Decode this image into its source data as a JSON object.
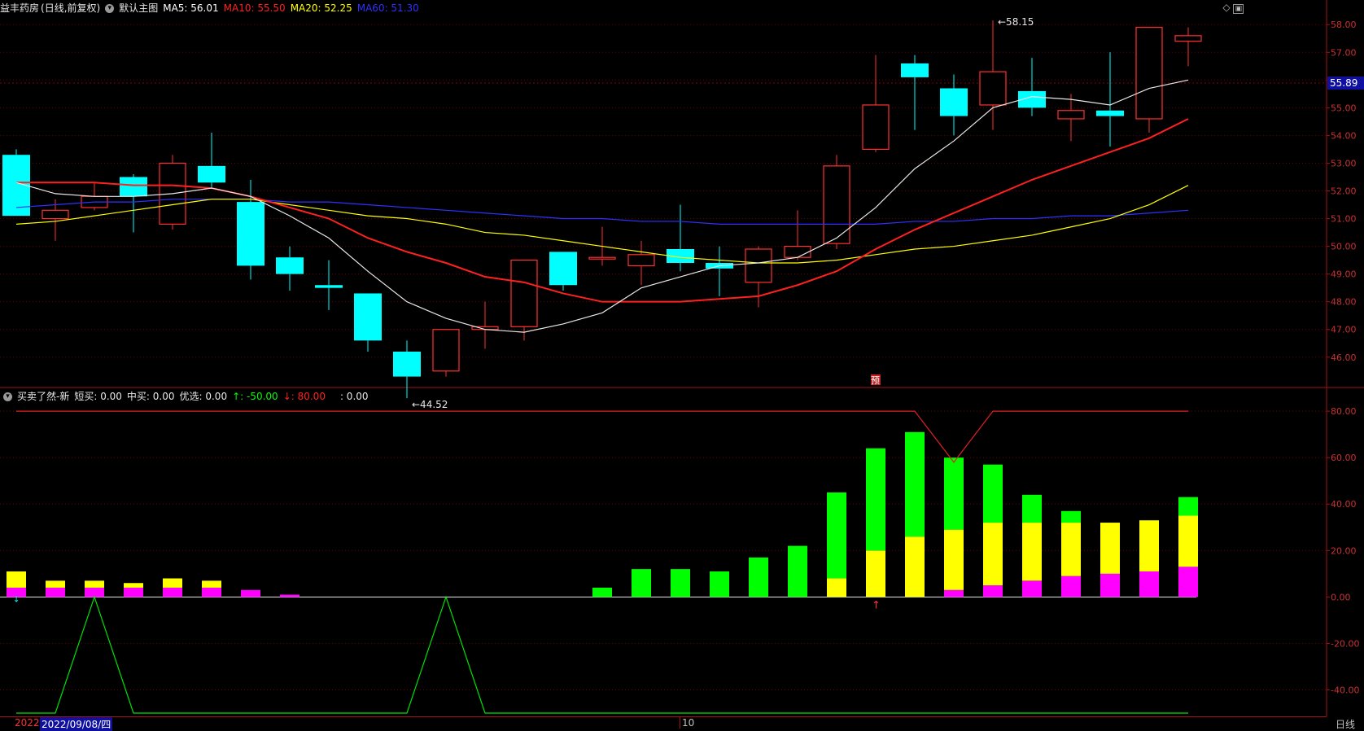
{
  "main_header": {
    "stock": "益丰药房",
    "mode": "(日线,前复权)",
    "template": "默认主图",
    "ma5": "MA5: 56.01",
    "ma10": "MA10: 55.50",
    "ma20": "MA20: 52.25",
    "ma60": "MA60: 51.30",
    "colors": {
      "ma5": "#ffffff",
      "ma10": "#ff2020",
      "ma20": "#ffff00",
      "ma60": "#3030ff"
    }
  },
  "sub_header": {
    "name": "买卖了然-新",
    "short": "短买: 0.00",
    "mid": "中买: 0.00",
    "pick": "优选: 0.00",
    "up": "↑: -50.00",
    "down": "↓: 80.00",
    "extra": ": 0.00"
  },
  "price_axis": {
    "ticks": [
      "58.00",
      "57.00",
      "56.00",
      "55.00",
      "54.00",
      "53.00",
      "52.00",
      "51.00",
      "50.00",
      "49.00",
      "48.00",
      "47.00",
      "46.00"
    ],
    "current": "55.89"
  },
  "indicator_axis": {
    "ticks": [
      "80.00",
      "60.00",
      "40.00",
      "20.00",
      "0.00",
      "-20.00",
      "-40.00"
    ]
  },
  "annotations": {
    "high": "58.15",
    "low": "44.52",
    "marker": "预"
  },
  "bottom": {
    "date_start": "2022",
    "date_selected": "2022/09/08/四",
    "month_mark": "10",
    "period": "日线"
  },
  "chart_data": [
    {
      "type": "candlestick",
      "ylim": [
        45.2,
        58.3
      ],
      "candles": [
        [
          53.3,
          51.1,
          53.5,
          51.1
        ],
        [
          51.0,
          51.3,
          51.7,
          50.2
        ],
        [
          51.4,
          51.8,
          52.3,
          51.3
        ],
        [
          52.5,
          51.8,
          52.6,
          50.5
        ],
        [
          50.8,
          53.0,
          53.3,
          50.6
        ],
        [
          52.9,
          52.3,
          54.1,
          52.1
        ],
        [
          51.6,
          49.3,
          52.4,
          48.8
        ],
        [
          49.6,
          49.0,
          50.0,
          48.4
        ],
        [
          48.6,
          48.5,
          49.5,
          47.7
        ],
        [
          48.3,
          46.6,
          48.3,
          46.2
        ],
        [
          46.2,
          45.3,
          46.6,
          44.52
        ],
        [
          45.5,
          47.0,
          47.0,
          45.3
        ],
        [
          47.0,
          47.1,
          48.0,
          46.3
        ],
        [
          47.1,
          49.5,
          49.5,
          46.6
        ],
        [
          49.8,
          48.6,
          49.8,
          48.4
        ],
        [
          49.6,
          49.6,
          50.7,
          49.3
        ],
        [
          49.3,
          49.7,
          50.2,
          48.6
        ],
        [
          49.9,
          49.4,
          51.5,
          49.1
        ],
        [
          49.4,
          49.2,
          50.0,
          48.2
        ],
        [
          48.7,
          49.9,
          50.0,
          47.8
        ],
        [
          49.6,
          50.0,
          51.3,
          49.5
        ],
        [
          50.1,
          52.9,
          53.3,
          49.9
        ],
        [
          53.5,
          55.1,
          56.9,
          53.4
        ],
        [
          56.6,
          56.1,
          56.9,
          54.2
        ],
        [
          55.7,
          54.7,
          56.2,
          54.0
        ],
        [
          55.1,
          56.3,
          58.15,
          54.2
        ],
        [
          55.6,
          55.0,
          56.8,
          54.7
        ],
        [
          54.6,
          54.9,
          55.5,
          53.8
        ],
        [
          54.9,
          54.7,
          57.0,
          53.6
        ],
        [
          54.6,
          57.9,
          57.9,
          54.1
        ],
        [
          57.4,
          57.6,
          57.9,
          56.5
        ]
      ],
      "ma5": [
        52.3,
        51.9,
        51.8,
        51.8,
        51.9,
        52.1,
        51.8,
        51.1,
        50.3,
        49.1,
        48.0,
        47.4,
        47.0,
        46.9,
        47.2,
        47.6,
        48.5,
        48.9,
        49.3,
        49.4,
        49.6,
        50.3,
        51.4,
        52.8,
        53.8,
        55.0,
        55.4,
        55.3,
        55.1,
        55.7,
        56.0
      ],
      "ma10": [
        52.3,
        52.3,
        52.3,
        52.2,
        52.2,
        52.1,
        51.8,
        51.4,
        51.0,
        50.3,
        49.8,
        49.4,
        48.9,
        48.7,
        48.3,
        48.0,
        48.0,
        48.0,
        48.1,
        48.2,
        48.6,
        49.1,
        49.9,
        50.6,
        51.2,
        51.8,
        52.4,
        52.9,
        53.4,
        53.9,
        54.6
      ],
      "ma20": [
        50.8,
        50.9,
        51.1,
        51.3,
        51.5,
        51.7,
        51.7,
        51.5,
        51.3,
        51.1,
        51.0,
        50.8,
        50.5,
        50.4,
        50.2,
        50.0,
        49.8,
        49.6,
        49.5,
        49.4,
        49.4,
        49.5,
        49.7,
        49.9,
        50.0,
        50.2,
        50.4,
        50.7,
        51.0,
        51.5,
        52.2
      ],
      "ma60": [
        51.4,
        51.5,
        51.6,
        51.6,
        51.7,
        51.7,
        51.7,
        51.6,
        51.6,
        51.5,
        51.4,
        51.3,
        51.2,
        51.1,
        51.0,
        51.0,
        50.9,
        50.9,
        50.8,
        50.8,
        50.8,
        50.8,
        50.8,
        50.9,
        50.9,
        51.0,
        51.0,
        51.1,
        51.1,
        51.2,
        51.3
      ]
    },
    {
      "type": "bar",
      "ylim": [
        -50,
        86
      ],
      "series": [
        {
          "name": "短买",
          "color": "#ff00ff",
          "values": [
            4,
            4,
            4,
            4,
            4,
            4,
            3,
            1,
            0,
            0,
            0,
            0,
            0,
            0,
            0,
            0,
            0,
            0,
            0,
            0,
            0,
            0,
            0,
            0,
            3,
            5,
            7,
            9,
            10,
            11,
            13,
            15
          ]
        },
        {
          "name": "中买",
          "color": "#ffff00",
          "values": [
            7,
            3,
            3,
            2,
            4,
            3,
            0,
            0,
            0,
            0,
            0,
            0,
            0,
            0,
            0,
            0,
            0,
            0,
            0,
            0,
            0,
            8,
            20,
            26,
            26,
            27,
            25,
            23,
            22,
            22,
            22,
            22
          ]
        },
        {
          "name": "优选",
          "color": "#00ff00",
          "values": [
            0,
            0,
            0,
            0,
            0,
            0,
            0,
            0,
            0,
            0,
            0,
            0,
            0,
            0,
            0,
            4,
            12,
            12,
            11,
            17,
            22,
            37,
            44,
            45,
            31,
            25,
            12,
            5,
            0,
            0,
            8,
            9
          ]
        }
      ],
      "up_line": [
        -50,
        -50,
        0,
        -50,
        -50,
        -50,
        -50,
        -50,
        -50,
        -50,
        -50,
        0,
        -50,
        -50,
        -50,
        -50,
        -50,
        -50,
        -50,
        -50,
        -50,
        -50,
        -50,
        -50,
        -50,
        -50,
        -50,
        -50,
        -50,
        -50,
        -50
      ],
      "down_line": [
        80,
        80,
        80,
        80,
        80,
        80,
        80,
        80,
        80,
        80,
        80,
        80,
        80,
        80,
        80,
        80,
        80,
        80,
        80,
        80,
        80,
        80,
        80,
        80,
        58,
        80,
        80,
        80,
        80,
        80,
        80
      ]
    }
  ]
}
